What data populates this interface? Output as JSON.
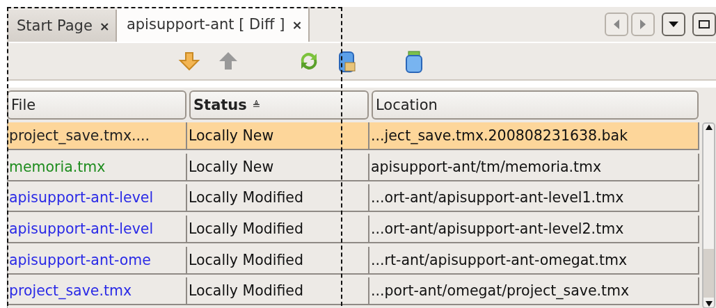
{
  "tabs": [
    {
      "label": "Start Page",
      "close": "×",
      "selected": false
    },
    {
      "label": "apisupport-ant [ Diff ]",
      "close": "×",
      "selected": true
    }
  ],
  "table": {
    "columns": [
      {
        "label": "File",
        "sorted": false
      },
      {
        "label": "Status",
        "sorted": true,
        "sort_mark": "≜"
      },
      {
        "label": "Location",
        "sorted": false
      }
    ],
    "rows": [
      {
        "file": "project_save.tmx....",
        "status": "Locally New",
        "location": "...ject_save.tmx.200808231638.bak",
        "color": "#222222",
        "selected": true
      },
      {
        "file": "memoria.tmx",
        "status": "Locally New",
        "location": "apisupport-ant/tm/memoria.tmx",
        "color": "#1e8c1e",
        "selected": false
      },
      {
        "file": "apisupport-ant-level",
        "status": "Locally Modified",
        "location": "...ort-ant/apisupport-ant-level1.tmx",
        "color": "#2a2ae6",
        "selected": false
      },
      {
        "file": "apisupport-ant-level",
        "status": "Locally Modified",
        "location": "...ort-ant/apisupport-ant-level2.tmx",
        "color": "#2a2ae6",
        "selected": false
      },
      {
        "file": "apisupport-ant-ome",
        "status": "Locally Modified",
        "location": "...rt-ant/apisupport-ant-omegat.tmx",
        "color": "#2a2ae6",
        "selected": false
      },
      {
        "file": "project_save.tmx",
        "status": "Locally Modified",
        "location": "...port-ant/omegat/project_save.tmx",
        "color": "#2a2ae6",
        "selected": false
      }
    ]
  }
}
